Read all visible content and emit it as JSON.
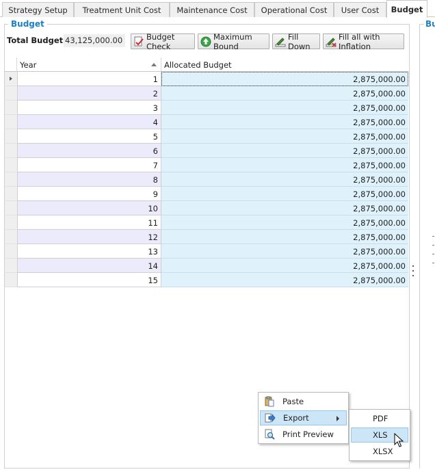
{
  "tabs": [
    {
      "label": "Strategy Setup",
      "active": false
    },
    {
      "label": "Treatment Unit Cost",
      "active": false
    },
    {
      "label": "Maintenance Cost",
      "active": false
    },
    {
      "label": "Operational Cost",
      "active": false
    },
    {
      "label": "User Cost",
      "active": false
    },
    {
      "label": "Budget",
      "active": true
    }
  ],
  "group": {
    "title": "Budget",
    "right_title": "Bu"
  },
  "toolbar": {
    "total_label": "Total Budget :",
    "total_value": "43,125,000.00",
    "budget_check": "Budget Check",
    "maximum_bound": "Maximum Bound",
    "fill_down": "Fill Down",
    "fill_inflation": "Fill all with Inflation"
  },
  "grid": {
    "columns": [
      "Year",
      "Allocated Budget"
    ],
    "rows": [
      {
        "year": "1",
        "budget": "2,875,000.00"
      },
      {
        "year": "2",
        "budget": "2,875,000.00"
      },
      {
        "year": "3",
        "budget": "2,875,000.00"
      },
      {
        "year": "4",
        "budget": "2,875,000.00"
      },
      {
        "year": "5",
        "budget": "2,875,000.00"
      },
      {
        "year": "6",
        "budget": "2,875,000.00"
      },
      {
        "year": "7",
        "budget": "2,875,000.00"
      },
      {
        "year": "8",
        "budget": "2,875,000.00"
      },
      {
        "year": "9",
        "budget": "2,875,000.00"
      },
      {
        "year": "10",
        "budget": "2,875,000.00"
      },
      {
        "year": "11",
        "budget": "2,875,000.00"
      },
      {
        "year": "12",
        "budget": "2,875,000.00"
      },
      {
        "year": "13",
        "budget": "2,875,000.00"
      },
      {
        "year": "14",
        "budget": "2,875,000.00"
      },
      {
        "year": "15",
        "budget": "2,875,000.00"
      }
    ]
  },
  "context_menu": {
    "paste": "Paste",
    "export": "Export",
    "print_preview": "Print Preview"
  },
  "export_submenu": [
    "PDF",
    "XLS",
    "XLSX"
  ],
  "colors": {
    "accent": "#1c82c4",
    "alloc_cell": "#dff2fb",
    "alt_row": "#ebebfb",
    "menu_highlight": "#cde6f7"
  }
}
